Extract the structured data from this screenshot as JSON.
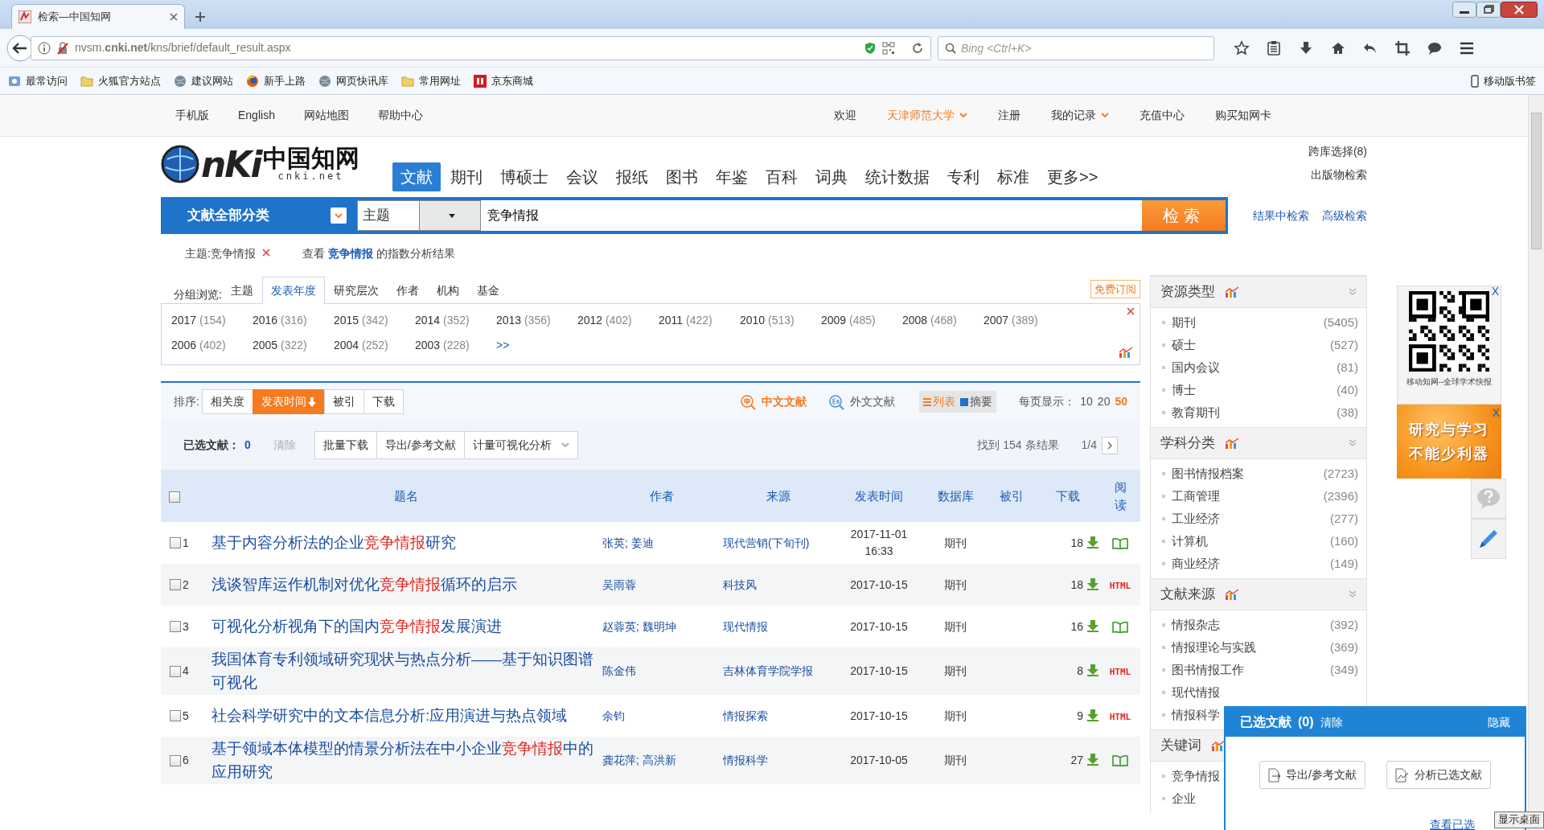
{
  "browser": {
    "tabs": [
      {
        "title": "检索—中国知网",
        "selected": true
      }
    ],
    "url": "nvsm.**cnki.net**/kns/brief/default_result.aspx",
    "search_placeholder": "Bing <Ctrl+K>",
    "bookmarks": [
      {
        "label": "最常访问",
        "kind": "frequent"
      },
      {
        "label": "火狐官方站点",
        "kind": "folder"
      },
      {
        "label": "建议网站",
        "kind": "globe"
      },
      {
        "label": "新手上路",
        "kind": "firefox"
      },
      {
        "label": "网页快讯库",
        "kind": "globe"
      },
      {
        "label": "常用网址",
        "kind": "folder"
      },
      {
        "label": "京东商城",
        "kind": "jd"
      }
    ],
    "mobile_bookmarks": "移动版书签"
  },
  "site_nav": {
    "left": [
      "手机版",
      "English",
      "网站地图",
      "帮助中心"
    ],
    "right": [
      {
        "label": "欢迎",
        "highlight": false,
        "dropdown": false
      },
      {
        "label": "天津师范大学",
        "highlight": true,
        "dropdown": true
      },
      {
        "label": "注册",
        "highlight": false,
        "dropdown": false
      },
      {
        "label": "我的记录",
        "highlight": false,
        "dropdown": true
      },
      {
        "label": "充值中心",
        "highlight": false,
        "dropdown": false
      },
      {
        "label": "购买知网卡",
        "highlight": false,
        "dropdown": false
      }
    ]
  },
  "logo": {
    "mark": "nKi",
    "name": "中国知网",
    "domain": "cnki.net"
  },
  "db_tabs": [
    {
      "label": "文献",
      "selected": true
    },
    {
      "label": "期刊",
      "selected": false
    },
    {
      "label": "博硕士",
      "selected": false
    },
    {
      "label": "会议",
      "selected": false
    },
    {
      "label": "报纸",
      "selected": false
    },
    {
      "label": "图书",
      "selected": false
    },
    {
      "label": "年鉴",
      "selected": false
    },
    {
      "label": "百科",
      "selected": false
    },
    {
      "label": "词典",
      "selected": false
    },
    {
      "label": "统计数据",
      "selected": false
    },
    {
      "label": "专利",
      "selected": false
    },
    {
      "label": "标准",
      "selected": false
    },
    {
      "label": "更多>>",
      "selected": false
    }
  ],
  "side_links": {
    "cross_db": "跨库选择(8)",
    "publication": "出版物检索",
    "in_results": "结果中检索",
    "advanced": "高级检索"
  },
  "search": {
    "category": "文献全部分类",
    "field": "主题",
    "value": "竞争情报",
    "button": "检索"
  },
  "query": {
    "tag": "主题:竞争情报",
    "before": "查看",
    "link": "竞争情报",
    "after": "的指数分析结果"
  },
  "group_browse": {
    "label": "分组浏览:",
    "tabs": [
      {
        "label": "主题",
        "selected": false
      },
      {
        "label": "发表年度",
        "selected": true
      },
      {
        "label": "研究层次",
        "selected": false
      },
      {
        "label": "作者",
        "selected": false
      },
      {
        "label": "机构",
        "selected": false
      },
      {
        "label": "基金",
        "selected": false
      }
    ],
    "subscribe": "免费订阅",
    "years": [
      {
        "year": "2017",
        "count": "(154)"
      },
      {
        "year": "2016",
        "count": "(316)"
      },
      {
        "year": "2015",
        "count": "(342)"
      },
      {
        "year": "2014",
        "count": "(352)"
      },
      {
        "year": "2013",
        "count": "(356)"
      },
      {
        "year": "2012",
        "count": "(402)"
      },
      {
        "year": "2011",
        "count": "(422)"
      },
      {
        "year": "2010",
        "count": "(513)"
      },
      {
        "year": "2009",
        "count": "(485)"
      },
      {
        "year": "2008",
        "count": "(468)"
      },
      {
        "year": "2007",
        "count": "(389)"
      },
      {
        "year": "2006",
        "count": "(402)"
      },
      {
        "year": "2005",
        "count": "(322)"
      },
      {
        "year": "2004",
        "count": "(252)"
      },
      {
        "year": "2003",
        "count": "(228)"
      }
    ],
    "more": ">>"
  },
  "sort": {
    "label": "排序:",
    "options": [
      {
        "label": "相关度",
        "selected": false
      },
      {
        "label": "发表时间",
        "selected": true
      },
      {
        "label": "被引",
        "selected": false
      },
      {
        "label": "下载",
        "selected": false
      }
    ]
  },
  "language": [
    {
      "label": "中文文献",
      "selected": true,
      "kind": "zh"
    },
    {
      "label": "外文文献",
      "selected": false,
      "kind": "en"
    }
  ],
  "view": [
    {
      "label": "列表",
      "selected": true
    },
    {
      "label": "摘要",
      "selected": false
    }
  ],
  "per_page": {
    "label": "每页显示：",
    "options": [
      {
        "label": "10",
        "selected": false
      },
      {
        "label": "20",
        "selected": false
      },
      {
        "label": "50",
        "selected": true
      }
    ]
  },
  "selection": {
    "label": "已选文献：",
    "count": "0",
    "clear": "清除",
    "buttons": [
      {
        "label": "批量下载",
        "dropdown": false
      },
      {
        "label": "导出/参考文献",
        "dropdown": false
      },
      {
        "label": "计量可视化分析",
        "dropdown": true
      }
    ],
    "found": "找到 154 条结果",
    "page": "1/4"
  },
  "table": {
    "select_all": {
      "checked": false
    },
    "columns": [
      "题名",
      "作者",
      "来源",
      "发表时间",
      "数据库",
      "被引",
      "下载",
      "阅读"
    ],
    "rows": [
      {
        "number": "1",
        "checked": false,
        "title": "基于内容分析法的企业**竞争情报**研究",
        "authors": "张英; 姜迪",
        "source": "现代营销(下旬刊)",
        "date": "2017-11-01 16:33",
        "database": "期刊",
        "downloads": "18",
        "kind": "book"
      },
      {
        "number": "2",
        "checked": false,
        "title": "浅谈智库运作机制对优化**竞争情报**循环的启示",
        "authors": "吴雨蓉",
        "source": "科技风",
        "date": "2017-10-15",
        "database": "期刊",
        "downloads": "18",
        "kind": "html",
        "read_label": "HTML"
      },
      {
        "number": "3",
        "checked": false,
        "title": "可视化分析视角下的国内**竞争情报**发展演进",
        "authors": "赵蓉英; 魏明坤",
        "source": "现代情报",
        "date": "2017-10-15",
        "database": "期刊",
        "downloads": "16",
        "kind": "book"
      },
      {
        "number": "4",
        "checked": false,
        "title": "我国体育专利领域研究现状与热点分析——基于知识图谱可视化",
        "authors": "陈金伟",
        "source": "吉林体育学院学报",
        "date": "2017-10-15",
        "database": "期刊",
        "downloads": "8",
        "kind": "html",
        "read_label": "HTML"
      },
      {
        "number": "5",
        "checked": false,
        "title": "社会科学研究中的文本信息分析:应用演进与热点领域",
        "authors": "余钧",
        "source": "情报探索",
        "date": "2017-10-15",
        "database": "期刊",
        "downloads": "9",
        "kind": "html",
        "read_label": "HTML"
      },
      {
        "number": "6",
        "checked": false,
        "title": "基于领域本体模型的情景分析法在中小企业**竞争情报**中的应用研究",
        "authors": "龚花萍; 高洪新",
        "source": "情报科学",
        "date": "2017-10-05",
        "database": "期刊",
        "downloads": "27",
        "kind": "book"
      }
    ]
  },
  "sidebar": [
    {
      "title": "资源类型",
      "items": [
        {
          "name": "期刊",
          "count": "(5405)"
        },
        {
          "name": "硕士",
          "count": "(527)"
        },
        {
          "name": "国内会议",
          "count": "(81)"
        },
        {
          "name": "博士",
          "count": "(40)"
        },
        {
          "name": "教育期刊",
          "count": "(38)"
        }
      ]
    },
    {
      "title": "学科分类",
      "items": [
        {
          "name": "图书情报档案",
          "count": "(2723)"
        },
        {
          "name": "工商管理",
          "count": "(2396)"
        },
        {
          "name": "工业经济",
          "count": "(277)"
        },
        {
          "name": "计算机",
          "count": "(160)"
        },
        {
          "name": "商业经济",
          "count": "(149)"
        }
      ]
    },
    {
      "title": "文献来源",
      "items": [
        {
          "name": "情报杂志",
          "count": "(392)"
        },
        {
          "name": "情报理论与实践",
          "count": "(369)"
        },
        {
          "name": "图书情报工作",
          "count": "(349)"
        },
        {
          "name": "现代情报"
        },
        {
          "name": "情报科学"
        }
      ]
    },
    {
      "title": "关键词",
      "items": [
        {
          "name": "竞争情报"
        },
        {
          "name": "企业"
        }
      ]
    }
  ],
  "ads": {
    "qr_caption": "移动知网--全球学术快报",
    "qr_close": "X",
    "banner_lines": [
      "研究与学习",
      "不能少利器"
    ],
    "banner_close": "X"
  },
  "selected_panel": {
    "title": "已选文献",
    "count": "(0)",
    "clear": "清除",
    "hide": "隐藏",
    "buttons": [
      "导出/参考文献",
      "分析已选文献"
    ],
    "view_link": "查看已选"
  },
  "desktop_tooltip": "显示桌面"
}
